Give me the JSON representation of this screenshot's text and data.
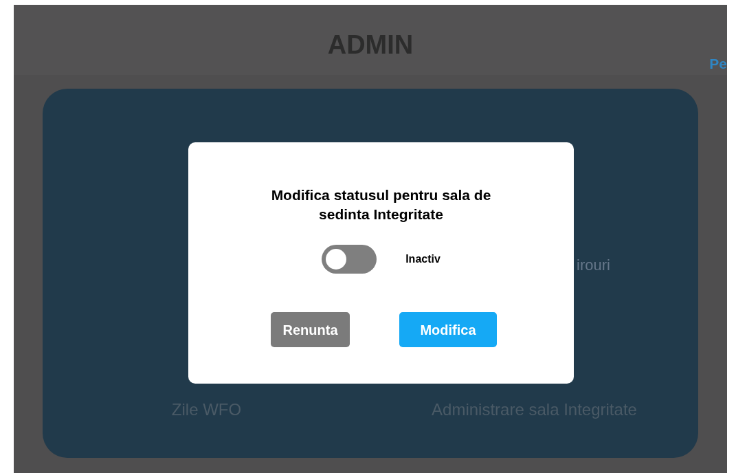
{
  "header": {
    "title": "ADMIN",
    "link": "Pe"
  },
  "tiles": [
    {
      "label": "irouri",
      "kind": "upper"
    },
    {
      "label": "Zile WFO",
      "kind": "lower"
    },
    {
      "label": "Administrare sala Integritate",
      "kind": "lower"
    }
  ],
  "dialog": {
    "title": "Modifica statusul pentru sala de sedinta Integritate",
    "toggle": {
      "on": false,
      "label": "Inactiv"
    },
    "buttons": [
      {
        "label": "Renunta",
        "kind": "cancel"
      },
      {
        "label": "Modifica",
        "kind": "primary"
      }
    ]
  }
}
